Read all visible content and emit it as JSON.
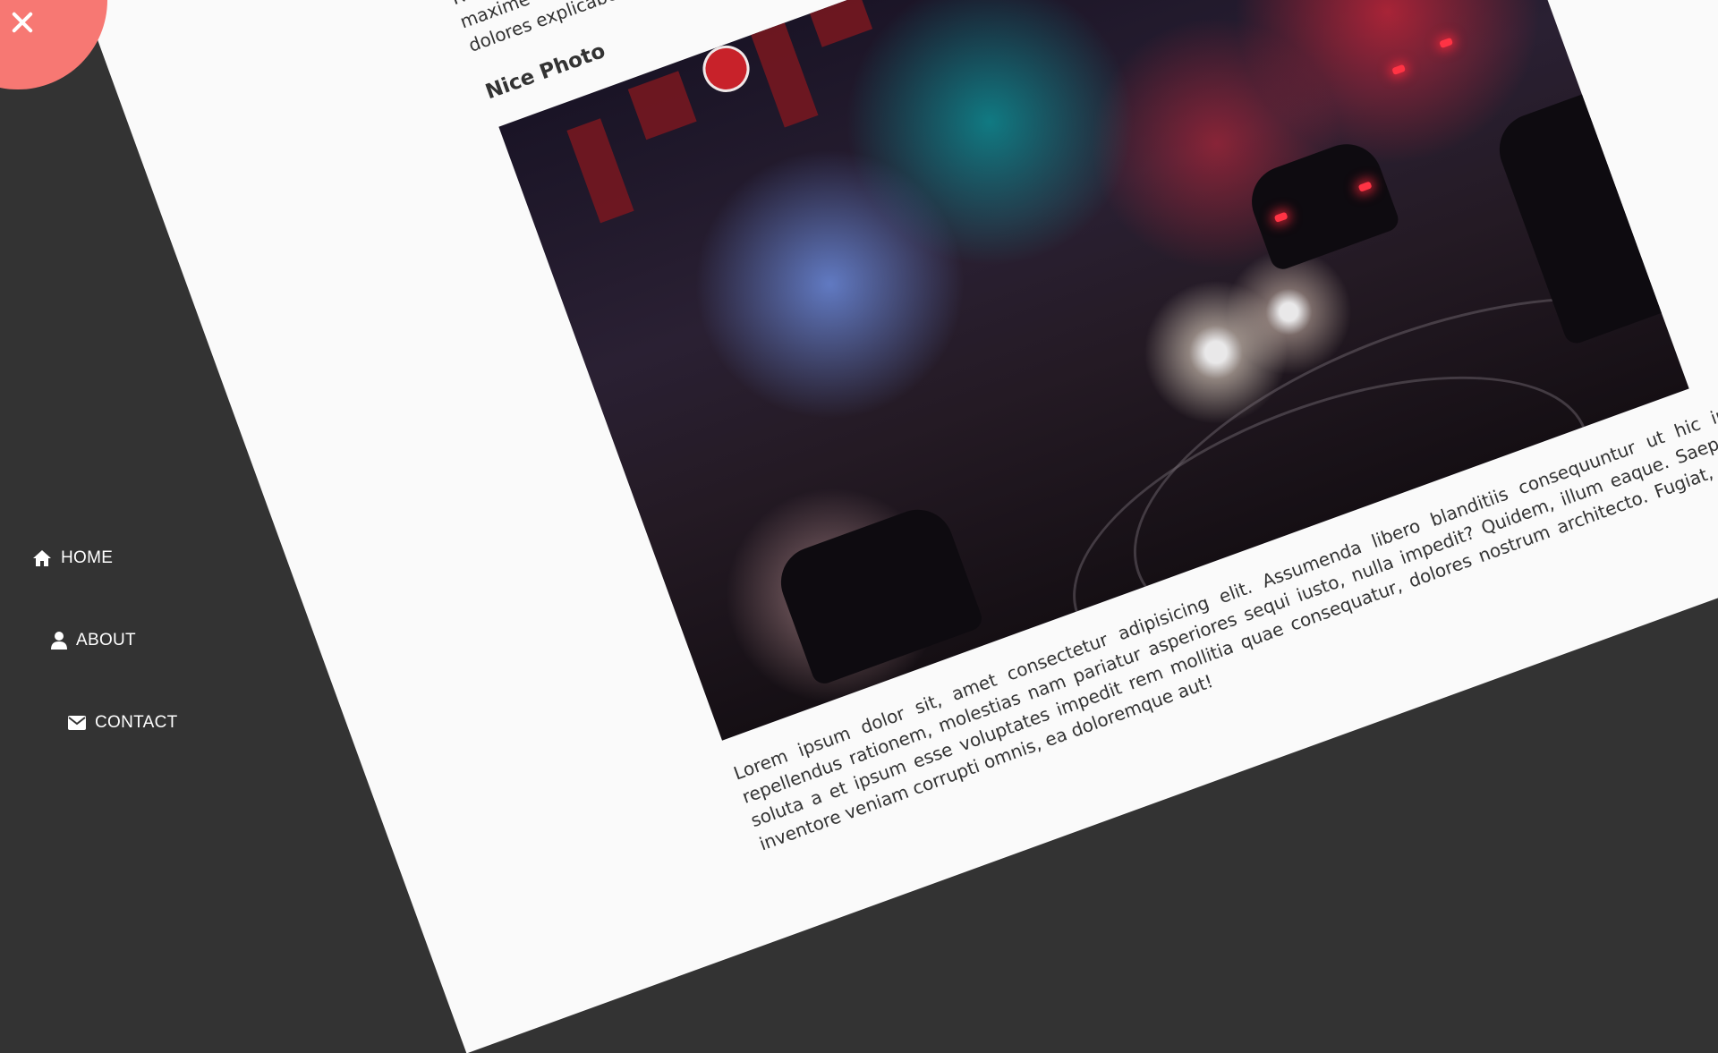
{
  "article": {
    "intro_text": "A... Lorem ipsum dolor sit amet, consectetur adipisicing elit. Ad accusantium unde aperiam nostrum eum est, mollitia. Rerum, assumenda voluptas eum est, mollitia cumque at, voluptas in possimus minima rerum fugit cumque at. Rerum maxime a id repellat sint. Dolores recusandae earum nostrum illum voluptate. Doloremque, cumque quaerat nulla dolores explicabo itaque, facilis nisi obcaecati eum ratione alias voluptatem. Aut!",
    "photo_heading": "Nice Photo",
    "photo_alt": "Night city street with traffic lights and cars",
    "body_text": "Lorem ipsum dolor sit, amet consectetur adipisicing elit. Assumenda libero blanditiis consequuntur ut hic iure repellendus rationem, molestias nam pariatur asperiores sequi iusto, nulla impedit? Quidem, illum eaque. Saepe id soluta a et ipsum esse voluptates impedit rem mollitia quae consequatur, dolores nostrum architecto. Fugiat, quos inventore veniam corrupti omnis, ea doloremque aut!"
  },
  "close_button": {
    "icon": "close-icon",
    "color": "#f77873"
  },
  "nav": {
    "items": [
      {
        "label": "HOME",
        "icon": "home-icon"
      },
      {
        "label": "ABOUT",
        "icon": "user-icon"
      },
      {
        "label": "CONTACT",
        "icon": "envelope-icon"
      }
    ]
  },
  "colors": {
    "sidebar": "#333333",
    "page": "#fafafa",
    "text": "#333333",
    "accent": "#f77873"
  }
}
